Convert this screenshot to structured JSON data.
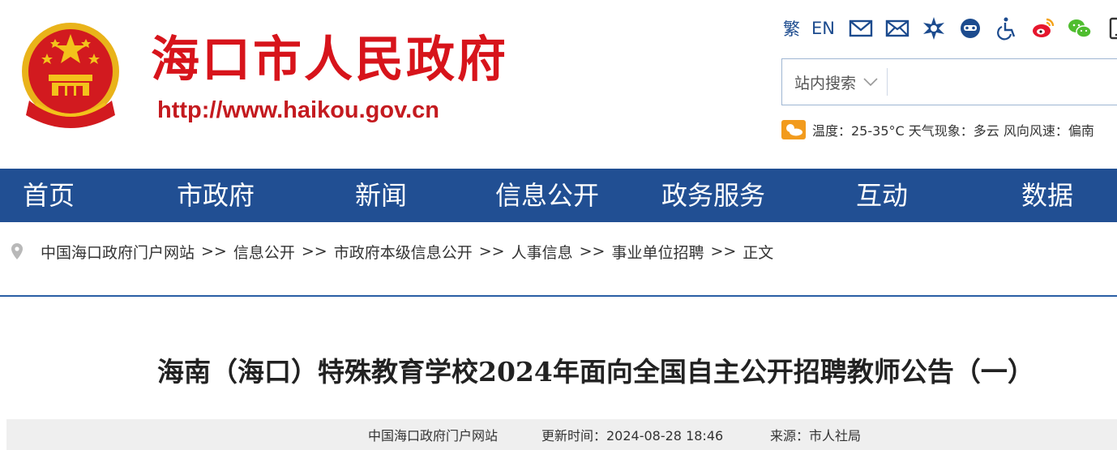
{
  "header": {
    "site_name": "海口市人民政府",
    "site_url": "http://www.haikou.gov.cn",
    "tools": {
      "traditional": "繁",
      "english": "EN"
    },
    "search": {
      "scope": "站内搜索",
      "placeholder": ""
    },
    "weather": {
      "text": "温度：25-35°C 天气现象：多云 风向风速：偏南"
    }
  },
  "nav": {
    "items": [
      "首页",
      "市政府",
      "新闻",
      "信息公开",
      "政务服务",
      "互动",
      "数据"
    ]
  },
  "breadcrumb": {
    "items": [
      "中国海口政府门户网站",
      "信息公开",
      "市政府本级信息公开",
      "人事信息",
      "事业单位招聘",
      "正文"
    ],
    "separator": ">>"
  },
  "article": {
    "title": "海南（海口）特殊教育学校2024年面向全国自主公开招聘教师公告（一）",
    "site": "中国海口政府门户网站",
    "updated": "更新时间：2024-08-28 18:46",
    "source": "来源：市人社局"
  },
  "colors": {
    "brand_red": "#d7141b",
    "nav_blue": "#214f93",
    "icon_blue": "#1c4b8e"
  }
}
